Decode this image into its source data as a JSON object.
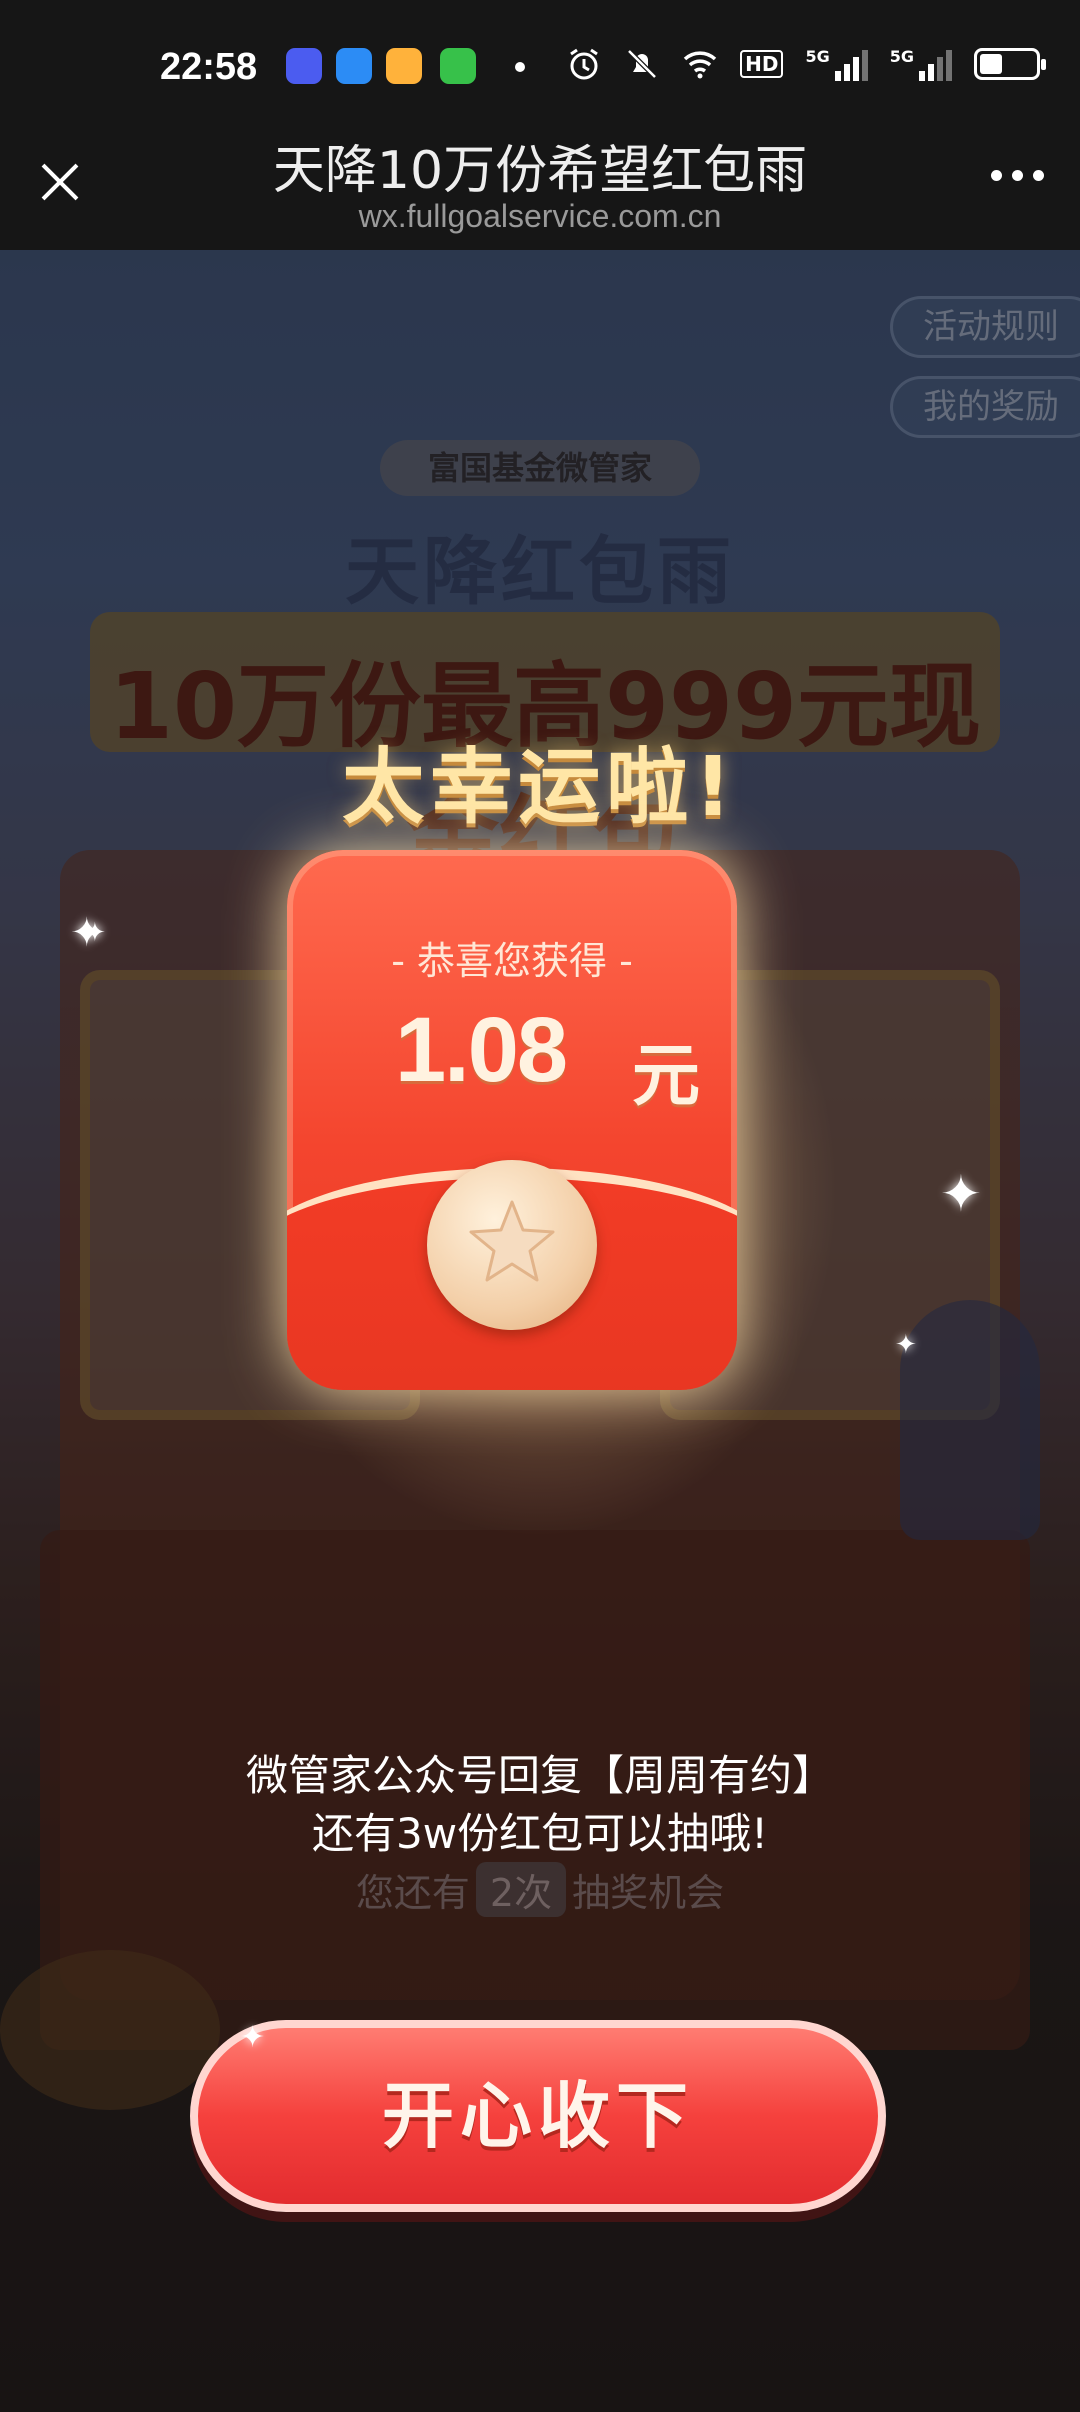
{
  "status_bar": {
    "time": "22:58",
    "app_icons": [
      {
        "name": "cloud-app-icon",
        "color": "#4b5cf0"
      },
      {
        "name": "link-app-icon",
        "color": "#2c8cf5"
      },
      {
        "name": "wallet-app-icon",
        "color": "#ffb23b"
      },
      {
        "name": "calculator-app-icon",
        "color": "#37c14a"
      }
    ],
    "hd_label": "HD",
    "signal_label_1": "5G",
    "signal_label_2": "5G",
    "battery_level": 0.4
  },
  "title_bar": {
    "title": "天降10万份希望红包雨",
    "url": "wx.fullgoalservice.com.cn"
  },
  "background": {
    "rules_button": "活动规则",
    "rewards_button": "我的奖励",
    "brand": "富国基金微管家",
    "headline": "天降红包雨",
    "ribbon": "10万份最高999元现金红包"
  },
  "popup": {
    "title": "太幸运啦!",
    "envelope_subtitle": "- 恭喜您获得 -",
    "amount": "1.08",
    "unit": "元",
    "notice_line1": "微管家公众号回复【周周有约】",
    "notice_line2": "还有3w份红包可以抽哦!",
    "chance_prefix": "您还有",
    "chance_count": "2次",
    "chance_suffix": "抽奖机会",
    "accept_button": "开心收下"
  }
}
